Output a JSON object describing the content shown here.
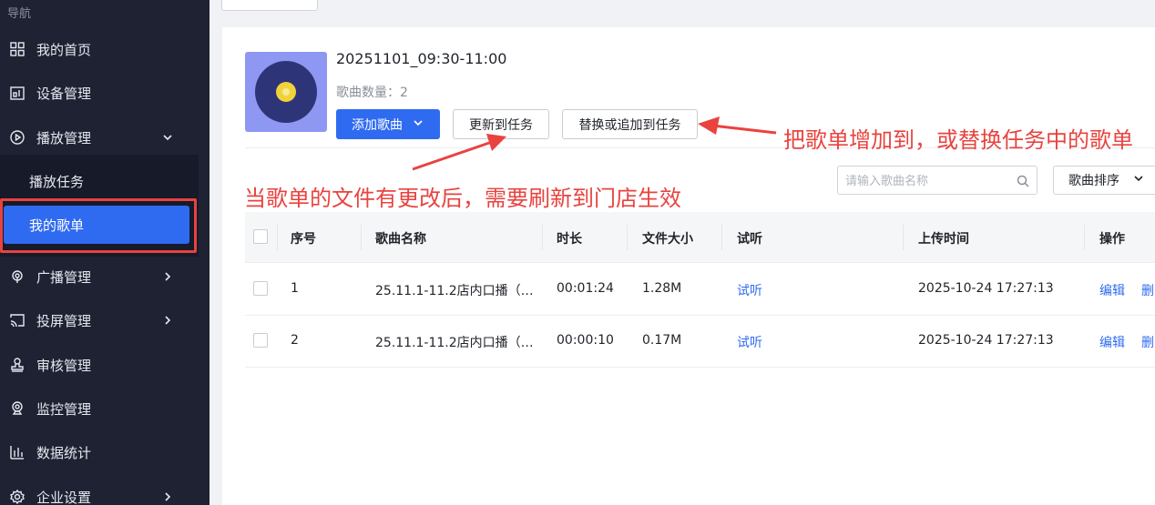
{
  "sidebar": {
    "nav_title": "导航",
    "items": [
      {
        "label": "我的首页",
        "icon": "grid-icon"
      },
      {
        "label": "设备管理",
        "icon": "device-icon"
      },
      {
        "label": "播放管理",
        "icon": "play-circle-icon"
      },
      {
        "label": "广播管理",
        "icon": "broadcast-icon"
      },
      {
        "label": "投屏管理",
        "icon": "cast-icon"
      },
      {
        "label": "审核管理",
        "icon": "stamp-icon"
      },
      {
        "label": "监控管理",
        "icon": "camera-icon"
      },
      {
        "label": "数据统计",
        "icon": "bar-chart-icon"
      },
      {
        "label": "企业设置",
        "icon": "settings-icon"
      }
    ],
    "sub_items": [
      {
        "label": "播放任务"
      },
      {
        "label": "我的歌单",
        "active": true
      }
    ]
  },
  "playlist": {
    "title": "20251101_09:30-11:00",
    "count_label": "歌曲数量：",
    "count_value": "2",
    "add_button": "添加歌曲",
    "update_button": "更新到任务",
    "replace_button": "替换或追加到任务"
  },
  "annotations": {
    "right": "把歌单增加到，或替换任务中的歌单",
    "left": "当歌单的文件有更改后，需要刷新到门店生效",
    "color": "#e8433f"
  },
  "search": {
    "placeholder": "请输入歌曲名称"
  },
  "sort": {
    "label": "歌曲排序"
  },
  "table": {
    "headers": {
      "index": "序号",
      "name": "歌曲名称",
      "duration": "时长",
      "size": "文件大小",
      "preview": "试听",
      "uploaded": "上传时间",
      "actions": "操作"
    },
    "rows": [
      {
        "index": "1",
        "name": "25.11.1-11.2店内口播（…",
        "duration": "00:01:24",
        "size": "1.28M",
        "preview": "试听",
        "uploaded": "2025-10-24 17:27:13",
        "edit": "编辑",
        "delete": "删"
      },
      {
        "index": "2",
        "name": "25.11.1-11.2店内口播（…",
        "duration": "00:00:10",
        "size": "0.17M",
        "preview": "试听",
        "uploaded": "2025-10-24 17:27:13",
        "edit": "编辑",
        "delete": "删"
      }
    ]
  },
  "colors": {
    "accent": "#2f6bf0",
    "sidebar_bg": "#1f2233",
    "annotation": "#e8433f"
  }
}
